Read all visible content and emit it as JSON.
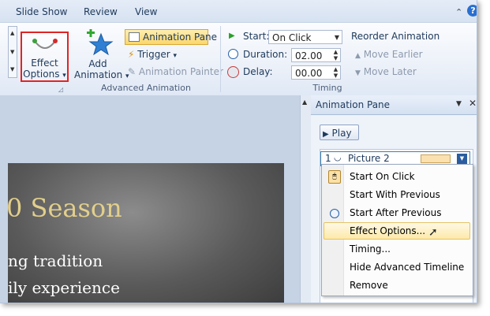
{
  "ribbon_tabs": [
    "Slide Show",
    "Review",
    "View"
  ],
  "effect_options": {
    "line1": "Effect",
    "line2": "Options",
    "arrow": "▾"
  },
  "add_animation": {
    "line1": "Add",
    "line2": "Animation",
    "arrow": "▾"
  },
  "advanced": {
    "animation_pane": "Animation Pane",
    "trigger": "Trigger",
    "trigger_arrow": "▾",
    "animation_painter": "Animation Painter",
    "group_label": "Advanced Animation"
  },
  "timing": {
    "start_label": "Start:",
    "start_value": "On Click",
    "duration_label": "Duration:",
    "duration_value": "02.00",
    "delay_label": "Delay:",
    "delay_value": "00.00",
    "group_label": "Timing"
  },
  "reorder": {
    "title": "Reorder Animation",
    "earlier": "Move Earlier",
    "later": "Move Later"
  },
  "slide": {
    "title": "0 Season",
    "line1": "ng tradition",
    "line2": "ily experience"
  },
  "pane": {
    "title": "Animation Pane",
    "play": "Play",
    "item_number": "1",
    "item_name": "Picture 2"
  },
  "menu": [
    {
      "label": "Start On Click",
      "icon": "mouse-click-icon",
      "highlighted": false
    },
    {
      "label": "Start With Previous",
      "icon": "",
      "highlighted": false
    },
    {
      "label": "Start After Previous",
      "icon": "clock-icon",
      "highlighted": false
    },
    {
      "label": "Effect Options...",
      "icon": "",
      "highlighted": true
    },
    {
      "label": "Timing...",
      "icon": "",
      "highlighted": false
    },
    {
      "label": "Hide Advanced Timeline",
      "icon": "",
      "highlighted": false
    },
    {
      "label": "Remove",
      "icon": "",
      "highlighted": false
    }
  ],
  "colors": {
    "highlight_box": "#e02424",
    "accent_blue": "#1f6fc6",
    "menu_highlight": "#fde9a9"
  }
}
